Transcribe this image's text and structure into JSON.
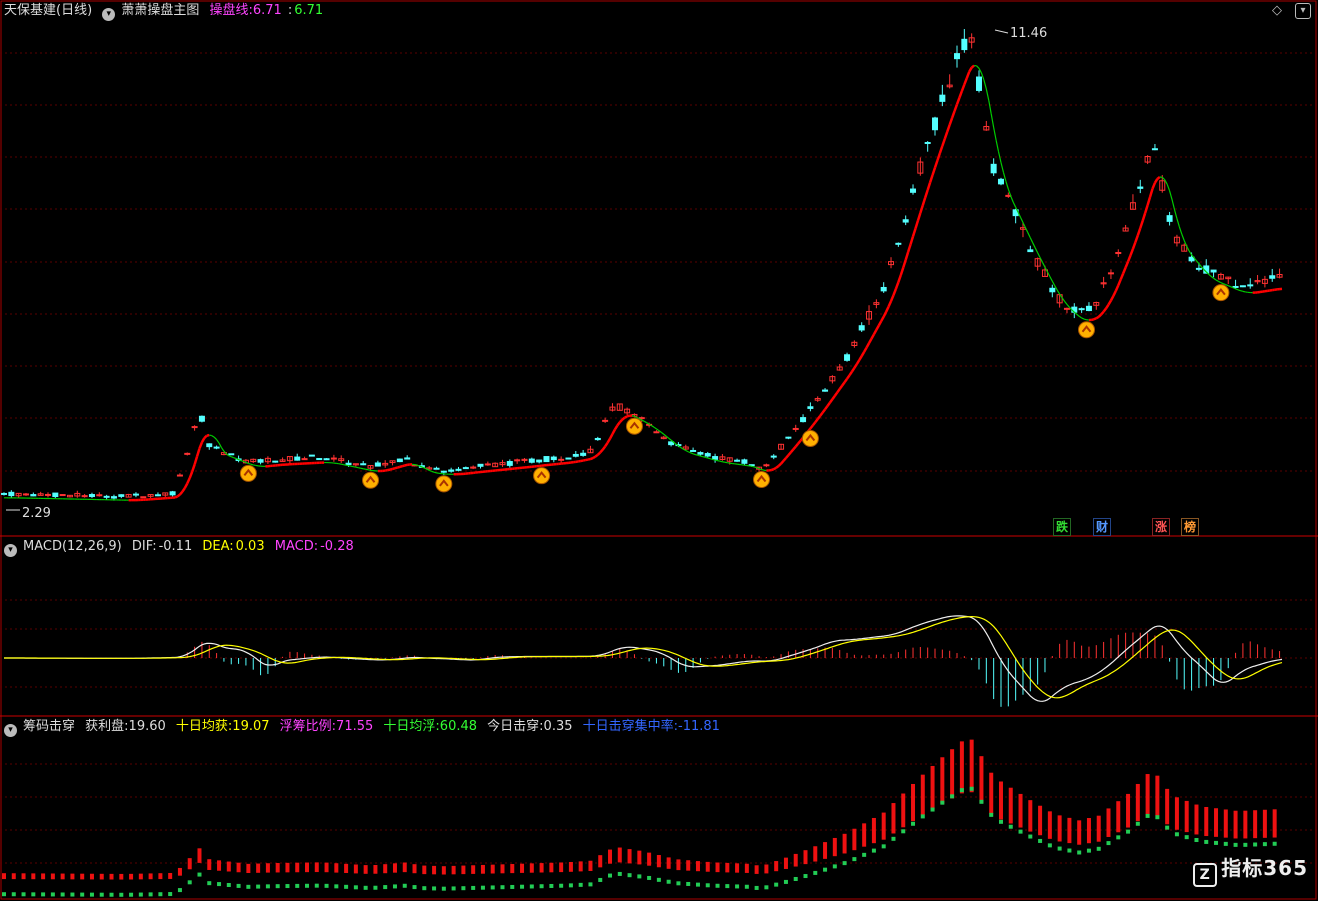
{
  "main_panel": {
    "stock_name": "天保基建",
    "period": "(日线)",
    "indicator_name": "萧萧操盘主图",
    "line_label": "操盘线:",
    "line_value1": "6.71",
    "line_sep": ":",
    "line_value2": "6.71",
    "high_label": "11.46",
    "low_label": "2.29",
    "badges": [
      "跌",
      "财",
      "涨",
      "榜"
    ],
    "colors": {
      "up": "#ff3232",
      "down": "#54ffff",
      "ma_up": "#ff0000",
      "ma_down": "#00cc00",
      "ma_turn": "#ff00ff"
    }
  },
  "macd_panel": {
    "title": "MACD(12,26,9)",
    "dif_label": "DIF:",
    "dif_value": "-0.11",
    "dea_label": "DEA:",
    "dea_value": "0.03",
    "macd_label": "MACD:",
    "macd_value": "-0.28"
  },
  "chip_panel": {
    "title": "筹码击穿",
    "profit_label": "获利盘:",
    "profit_value": "19.60",
    "avg10_label": "十日均获:",
    "avg10_value": "19.07",
    "float_label": "浮筹比例:",
    "float_value": "71.55",
    "avg10f_label": "十日均浮:",
    "avg10f_value": "60.48",
    "today_label": "今日击穿:",
    "today_value": "0.35",
    "conc_label": "十日击穿集中率:",
    "conc_value": "-11.81"
  },
  "watermark": "指标365",
  "chart_data": [
    {
      "type": "candlestick",
      "title": "萧萧操盘主图",
      "ylim": [
        2.29,
        11.46
      ],
      "close_profile": [
        [
          0,
          2.6
        ],
        [
          50,
          2.55
        ],
        [
          70,
          2.62
        ],
        [
          80,
          4.2
        ],
        [
          84,
          3.5
        ],
        [
          100,
          3.2
        ],
        [
          110,
          3.25
        ],
        [
          130,
          3.3
        ],
        [
          150,
          3.1
        ],
        [
          165,
          3.3
        ],
        [
          170,
          3.1
        ],
        [
          180,
          3.05
        ],
        [
          200,
          3.15
        ],
        [
          230,
          3.3
        ],
        [
          240,
          3.4
        ],
        [
          250,
          4.3
        ],
        [
          262,
          4.0
        ],
        [
          275,
          3.5
        ],
        [
          290,
          3.3
        ],
        [
          305,
          3.2
        ],
        [
          310,
          3.05
        ],
        [
          320,
          3.6
        ],
        [
          330,
          4.2
        ],
        [
          345,
          5.2
        ],
        [
          360,
          6.5
        ],
        [
          375,
          8.8
        ],
        [
          385,
          10.2
        ],
        [
          395,
          11.46
        ],
        [
          405,
          8.8
        ],
        [
          420,
          7.3
        ],
        [
          430,
          6.4
        ],
        [
          440,
          6.0
        ],
        [
          448,
          6.3
        ],
        [
          460,
          7.7
        ],
        [
          470,
          9.3
        ],
        [
          478,
          7.6
        ],
        [
          490,
          6.9
        ],
        [
          505,
          6.6
        ],
        [
          520,
          6.71
        ]
      ]
    },
    {
      "type": "line",
      "title": "MACD(12,26,9)",
      "series": [
        {
          "name": "DIF",
          "last": -0.11
        },
        {
          "name": "DEA",
          "last": 0.03
        },
        {
          "name": "MACD",
          "last": -0.28
        }
      ]
    },
    {
      "type": "bar",
      "title": "筹码击穿",
      "series": [
        {
          "name": "获利盘",
          "last": 19.6
        },
        {
          "name": "十日均获",
          "last": 19.07
        },
        {
          "name": "浮筹比例",
          "last": 71.55
        },
        {
          "name": "十日均浮",
          "last": 60.48
        }
      ]
    }
  ]
}
